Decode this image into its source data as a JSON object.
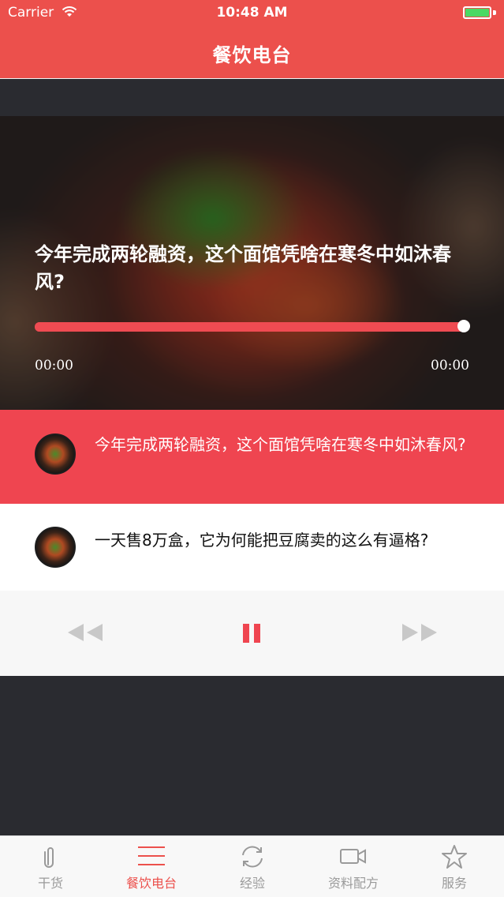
{
  "status_bar": {
    "carrier": "Carrier",
    "time": "10:48 AM"
  },
  "nav": {
    "title": "餐饮电台"
  },
  "player": {
    "title": "今年完成两轮融资，这个面馆凭啥在寒冬中如沐春风?",
    "elapsed": "00:00",
    "duration": "00:00",
    "progress_fraction": 1.0
  },
  "playlist": [
    {
      "title": "今年完成两轮融资，这个面馆凭啥在寒冬中如沐春风?",
      "active": true
    },
    {
      "title": "一天售8万盒，它为何能把豆腐卖的这么有逼格?",
      "active": false
    }
  ],
  "controls": {
    "prev_icon": "rewind-icon",
    "play_icon": "pause-icon",
    "next_icon": "fast-forward-icon"
  },
  "tabs": [
    {
      "label": "干货",
      "icon": "paperclip-icon"
    },
    {
      "label": "餐饮电台",
      "icon": "menu-lines-icon",
      "active": true
    },
    {
      "label": "经验",
      "icon": "refresh-icon"
    },
    {
      "label": "资料配方",
      "icon": "video-camera-icon"
    },
    {
      "label": "服务",
      "icon": "star-icon"
    }
  ],
  "colors": {
    "brand": "#ec504c",
    "active_row": "#ef4550",
    "tab_inactive": "#9a9a9a",
    "battery": "#4bd964"
  }
}
